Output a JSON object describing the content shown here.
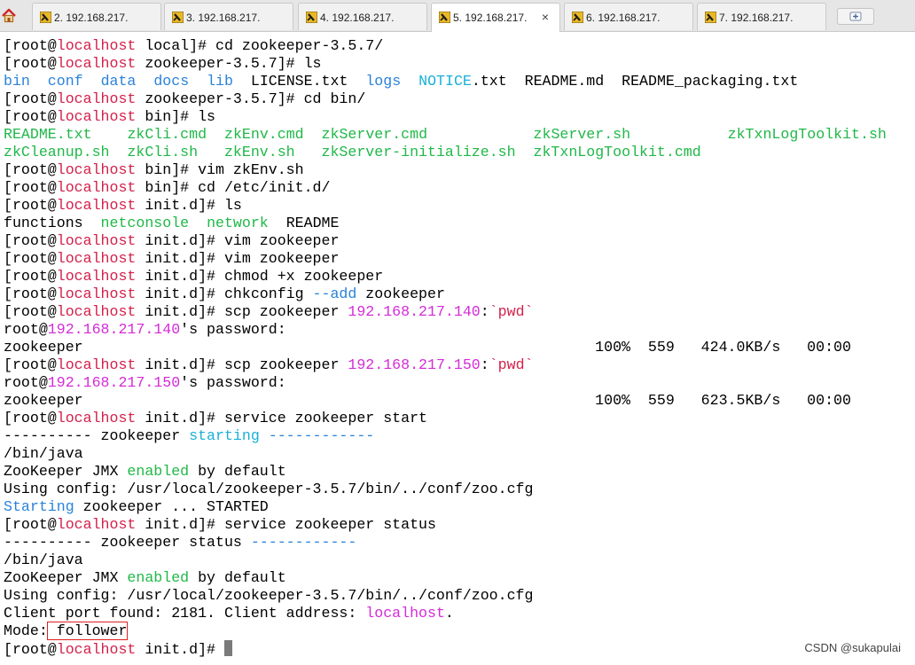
{
  "tabs": [
    {
      "label": "2. 192.168.217.",
      "active": false
    },
    {
      "label": "3. 192.168.217.",
      "active": false
    },
    {
      "label": "4. 192.168.217.",
      "active": false
    },
    {
      "label": "5. 192.168.217.",
      "active": true
    },
    {
      "label": "6. 192.168.217.",
      "active": false
    },
    {
      "label": "7. 192.168.217.",
      "active": false
    }
  ],
  "tab_close": "×",
  "terminal": {
    "lines": [
      [
        [
          "[root@",
          ""
        ],
        [
          "localhost",
          "red"
        ],
        [
          " local]# cd zookeeper-3.5.7/",
          ""
        ]
      ],
      [
        [
          "[root@",
          ""
        ],
        [
          "localhost",
          "red"
        ],
        [
          " zookeeper-3.5.7]# ls",
          ""
        ]
      ],
      [
        [
          "bin",
          "blue"
        ],
        [
          "  ",
          ""
        ],
        [
          "conf",
          "blue"
        ],
        [
          "  ",
          ""
        ],
        [
          "data",
          "blue"
        ],
        [
          "  ",
          ""
        ],
        [
          "docs",
          "blue"
        ],
        [
          "  ",
          ""
        ],
        [
          "lib",
          "blue"
        ],
        [
          "  LICENSE.txt  ",
          ""
        ],
        [
          "logs",
          "blue"
        ],
        [
          "  ",
          ""
        ],
        [
          "NOTICE",
          "cyan"
        ],
        [
          ".txt  README.md  README_packaging.txt",
          ""
        ]
      ],
      [
        [
          "[root@",
          ""
        ],
        [
          "localhost",
          "red"
        ],
        [
          " zookeeper-3.5.7]# cd bin/",
          ""
        ]
      ],
      [
        [
          "[root@",
          ""
        ],
        [
          "localhost",
          "red"
        ],
        [
          " bin]# ls",
          ""
        ]
      ],
      [
        [
          "README.txt",
          "green"
        ],
        [
          "    ",
          ""
        ],
        [
          "zkCli.cmd",
          "green"
        ],
        [
          "  ",
          ""
        ],
        [
          "zkEnv.cmd",
          "green"
        ],
        [
          "  ",
          ""
        ],
        [
          "zkServer.cmd",
          "green"
        ],
        [
          "            ",
          ""
        ],
        [
          "zkServer.sh",
          "green"
        ],
        [
          "           ",
          ""
        ],
        [
          "zkTxnLogToolkit.sh",
          "green"
        ]
      ],
      [
        [
          "zkCleanup.sh",
          "green"
        ],
        [
          "  ",
          ""
        ],
        [
          "zkCli.sh",
          "green"
        ],
        [
          "   ",
          ""
        ],
        [
          "zkEnv.sh",
          "green"
        ],
        [
          "   ",
          ""
        ],
        [
          "zkServer-initialize.sh",
          "green"
        ],
        [
          "  ",
          ""
        ],
        [
          "zkTxnLogToolkit.cmd",
          "green"
        ]
      ],
      [
        [
          "[root@",
          ""
        ],
        [
          "localhost",
          "red"
        ],
        [
          " bin]# vim zkEnv.sh",
          ""
        ]
      ],
      [
        [
          "[root@",
          ""
        ],
        [
          "localhost",
          "red"
        ],
        [
          " bin]# cd /etc/init.d/",
          ""
        ]
      ],
      [
        [
          "[root@",
          ""
        ],
        [
          "localhost",
          "red"
        ],
        [
          " init.d]# ls",
          ""
        ]
      ],
      [
        [
          "functions  ",
          ""
        ],
        [
          "netconsole",
          "green"
        ],
        [
          "  ",
          ""
        ],
        [
          "network",
          "green"
        ],
        [
          "  README",
          ""
        ]
      ],
      [
        [
          "[root@",
          ""
        ],
        [
          "localhost",
          "red"
        ],
        [
          " init.d]# vim zookeeper",
          ""
        ]
      ],
      [
        [
          "[root@",
          ""
        ],
        [
          "localhost",
          "red"
        ],
        [
          " init.d]# vim zookeeper",
          ""
        ]
      ],
      [
        [
          "[root@",
          ""
        ],
        [
          "localhost",
          "red"
        ],
        [
          " init.d]# chmod +x zookeeper",
          ""
        ]
      ],
      [
        [
          "[root@",
          ""
        ],
        [
          "localhost",
          "red"
        ],
        [
          " init.d]# chkconfig ",
          ""
        ],
        [
          "--add",
          "blue"
        ],
        [
          " zookeeper",
          ""
        ]
      ],
      [
        [
          "[root@",
          ""
        ],
        [
          "localhost",
          "red"
        ],
        [
          " init.d]# scp zookeeper ",
          ""
        ],
        [
          "192.168.217.140",
          "mag"
        ],
        [
          ":",
          ""
        ],
        [
          "`pwd`",
          "red"
        ]
      ],
      [
        [
          "root@",
          ""
        ],
        [
          "192.168.217.140",
          "mag"
        ],
        [
          "'s password:",
          ""
        ]
      ],
      [
        [
          "zookeeper                                                          100%  559   424.0KB/s   00:00",
          ""
        ]
      ],
      [
        [
          "[root@",
          ""
        ],
        [
          "localhost",
          "red"
        ],
        [
          " init.d]# scp zookeeper ",
          ""
        ],
        [
          "192.168.217.150",
          "mag"
        ],
        [
          ":",
          ""
        ],
        [
          "`pwd`",
          "red"
        ]
      ],
      [
        [
          "root@",
          ""
        ],
        [
          "192.168.217.150",
          "mag"
        ],
        [
          "'s password:",
          ""
        ]
      ],
      [
        [
          "zookeeper                                                          100%  559   623.5KB/s   00:00",
          ""
        ]
      ],
      [
        [
          "[root@",
          ""
        ],
        [
          "localhost",
          "red"
        ],
        [
          " init.d]# service zookeeper start",
          ""
        ]
      ],
      [
        [
          "---------- zookeeper ",
          ""
        ],
        [
          "starting",
          "cyan"
        ],
        [
          " ",
          ""
        ],
        [
          "------------",
          "blue"
        ]
      ],
      [
        [
          "/bin/java",
          ""
        ]
      ],
      [
        [
          "ZooKeeper JMX ",
          ""
        ],
        [
          "enabled",
          "green"
        ],
        [
          " by default",
          ""
        ]
      ],
      [
        [
          "Using config: /usr/local/zookeeper-3.5.7/bin/../conf/zoo.cfg",
          ""
        ]
      ],
      [
        [
          "Starting",
          "blue"
        ],
        [
          " zookeeper ... STARTED",
          ""
        ]
      ],
      [
        [
          "[root@",
          ""
        ],
        [
          "localhost",
          "red"
        ],
        [
          " init.d]# service zookeeper status",
          ""
        ]
      ],
      [
        [
          "---------- zookeeper status ",
          ""
        ],
        [
          "------------",
          "blue"
        ]
      ],
      [
        [
          "/bin/java",
          ""
        ]
      ],
      [
        [
          "ZooKeeper JMX ",
          ""
        ],
        [
          "enabled",
          "green"
        ],
        [
          " by default",
          ""
        ]
      ],
      [
        [
          "Using config: /usr/local/zookeeper-3.5.7/bin/../conf/zoo.cfg",
          ""
        ]
      ],
      [
        [
          "Client port found: 2181. Client address: ",
          ""
        ],
        [
          "localhost",
          "mag"
        ],
        [
          ".",
          ""
        ]
      ],
      [
        [
          "Mode:",
          ""
        ],
        [
          " follower",
          "box"
        ]
      ],
      [
        [
          "[root@",
          ""
        ],
        [
          "localhost",
          "red"
        ],
        [
          " init.d]# ",
          ""
        ]
      ]
    ]
  },
  "watermark": "CSDN @sukapulai"
}
